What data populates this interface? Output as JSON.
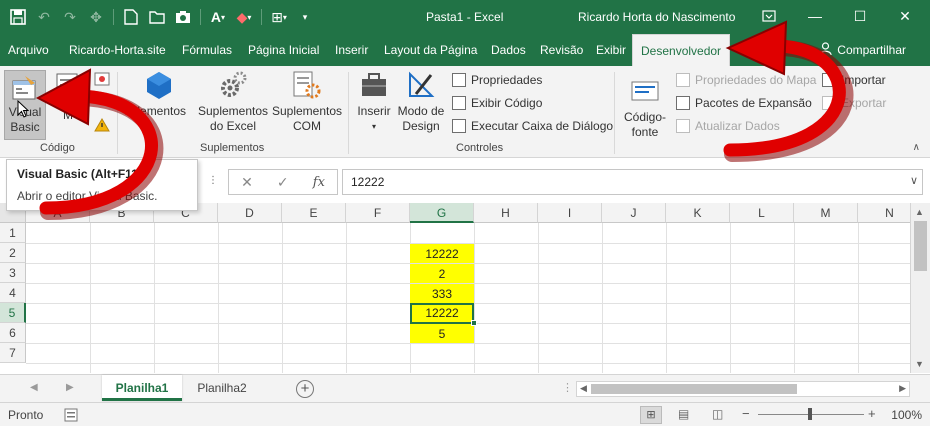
{
  "window": {
    "doc_title": "Pasta1  -  Excel",
    "user": "Ricardo Horta do Nascimento"
  },
  "qat": {
    "icons": [
      "save-icon",
      "undo-icon",
      "redo-icon",
      "touch-mode-icon",
      "new-file-icon",
      "open-folder-icon",
      "camera-icon",
      "font-color-icon",
      "fill-color-icon",
      "borders-icon",
      "customize-icon"
    ]
  },
  "tabs": [
    {
      "label": "Arquivo"
    },
    {
      "label": "Ricardo-Horta.site"
    },
    {
      "label": "Fórmulas"
    },
    {
      "label": "Página Inicial"
    },
    {
      "label": "Inserir"
    },
    {
      "label": "Layout da Página"
    },
    {
      "label": "Dados"
    },
    {
      "label": "Revisão"
    },
    {
      "label": "Exibir"
    },
    {
      "label": "Desenvolvedor"
    }
  ],
  "share_label": "Compartilhar",
  "ribbon": {
    "codigo": {
      "label": "Código",
      "visual_basic": "Visual Basic",
      "vb_line1": "Visual",
      "vb_line2": "Basic",
      "macros_partial": "M"
    },
    "suplementos": {
      "label": "Suplementos",
      "btn1": "uplementos",
      "btn2_l1": "Suplementos",
      "btn2_l2": "do Excel",
      "btn3_l1": "Suplementos",
      "btn3_l2": "COM"
    },
    "controles": {
      "label": "Controles",
      "inserir": "Inserir",
      "modo_l1": "Modo de",
      "modo_l2": "Design",
      "propriedades": "Propriedades",
      "exibir_codigo": "Exibir Código",
      "executar": "Executar Caixa de Diálogo"
    },
    "xml": {
      "codigo_fonte_l1": "Código-",
      "codigo_fonte_l2": "fonte",
      "propriedades_mapa": "Propriedades do Mapa",
      "pacotes": "Pacotes de Expansão",
      "atualizar": "Atualizar Dados",
      "importar": "Importar",
      "exportar": "Exportar"
    }
  },
  "tooltip": {
    "title": "Visual Basic (Alt+F11)",
    "description": "Abrir o editor Visual Basic."
  },
  "formula_bar": {
    "value": "12222"
  },
  "sheet": {
    "columns": [
      "A",
      "B",
      "C",
      "D",
      "E",
      "F",
      "G",
      "H",
      "I",
      "J",
      "K",
      "L",
      "M",
      "N"
    ],
    "rows": [
      "1",
      "2",
      "3",
      "4",
      "5",
      "6",
      "7"
    ],
    "selected_column": "G",
    "selected_row": "5",
    "cells": {
      "G2": "12222",
      "G3": "2",
      "G4": "333",
      "G5": "12222",
      "G6": "5"
    },
    "highlight_color": "#ffff00"
  },
  "sheet_tabs": [
    {
      "label": "Planilha1"
    },
    {
      "label": "Planilha2"
    }
  ],
  "status": {
    "ready": "Pronto",
    "zoom": "100%"
  },
  "colors": {
    "excel_green": "#217346",
    "arrow_red": "#e00000"
  }
}
